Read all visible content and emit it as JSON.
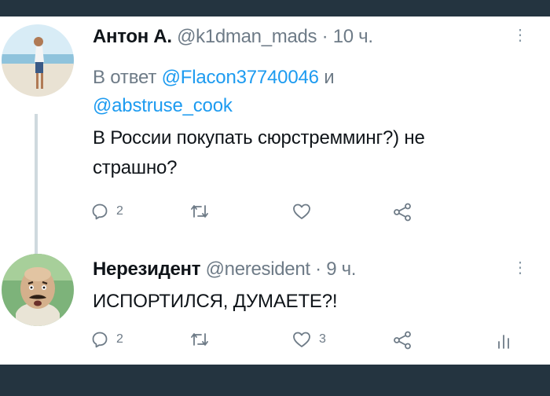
{
  "tweets": [
    {
      "author_name": "Антон А.",
      "handle": "@k1dman_mads",
      "separator": " · ",
      "time": "10 ч.",
      "reply_prefix": "В ответ ",
      "reply_mention_1": "@Flacon37740046",
      "reply_conjunction": " и",
      "reply_mention_2": "@abstruse_cook",
      "text_line_1": "В России покупать сюрстремминг?) не",
      "text_line_2": "страшно?",
      "reply_count": "2",
      "retweet_count": "",
      "like_count": "",
      "more_icon": "⋮"
    },
    {
      "author_name": "Нерезидент",
      "handle": "@neresident",
      "separator": " · ",
      "time": "9 ч.",
      "text_line_1": "ИСПОРТИЛСЯ, ДУМАЕТЕ?!",
      "reply_count": "2",
      "retweet_count": "",
      "like_count": "3",
      "more_icon": "⋮"
    }
  ],
  "icons": {
    "reply": "reply-icon",
    "retweet": "retweet-icon",
    "like": "like-icon",
    "share": "share-icon",
    "analytics": "analytics-icon",
    "more": "more-icon"
  },
  "colors": {
    "background": "#243440",
    "card": "#ffffff",
    "text": "#0f1419",
    "secondary": "#6e7b87",
    "link": "#1d9bf0",
    "thread_line": "#cfd9de"
  }
}
